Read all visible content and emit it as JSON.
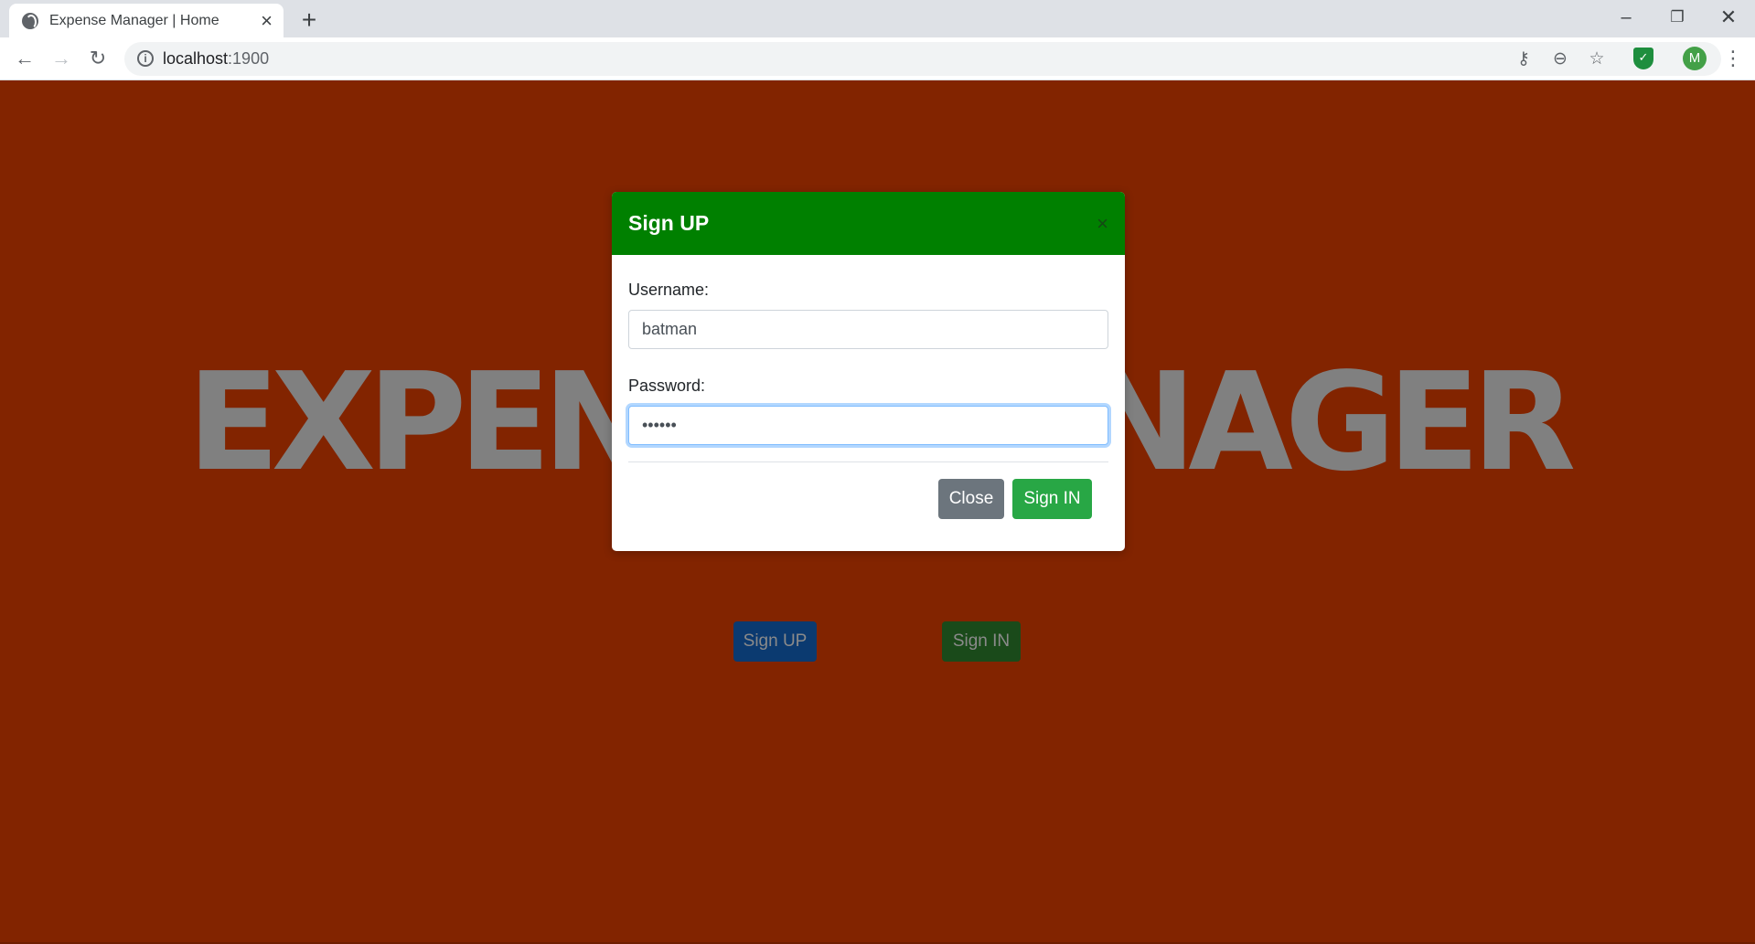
{
  "browser": {
    "tab_title": "Expense Manager | Home",
    "url_host": "localhost",
    "url_port": ":1900",
    "profile_initial": "M"
  },
  "page": {
    "hero_text": "EXPENSE MANAGER",
    "signup_label": "Sign UP",
    "signin_label": "Sign IN",
    "background_color": "#822400"
  },
  "modal": {
    "title": "Sign UP",
    "username_label": "Username:",
    "username_value": "batman",
    "password_label": "Password:",
    "password_value": "••••••",
    "close_label": "Close",
    "signin_label": "Sign IN",
    "header_color": "#008000"
  }
}
